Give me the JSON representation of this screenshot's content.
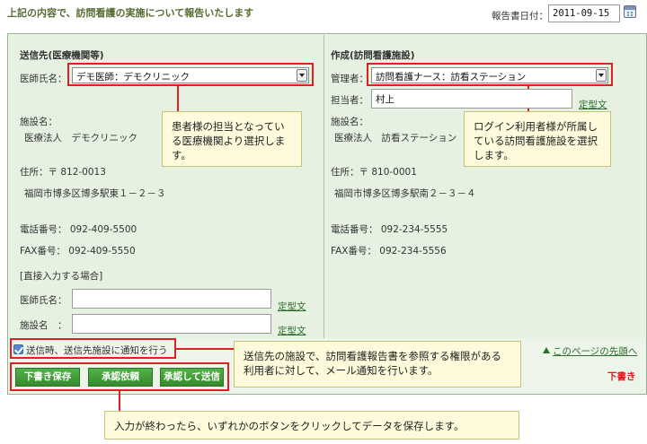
{
  "header": {
    "intro": "上記の内容で、訪問看護の実施について報告いたします",
    "report_date_label": "報告書日付：",
    "report_date": "2011-09-15"
  },
  "sender": {
    "title": "送信先(医療機関等)",
    "doctor_label": "医師氏名：",
    "doctor_selected": "デモ医師：デモクリニック",
    "facility_label": "施設名：",
    "facility_value": "医療法人　デモクリニック",
    "address_label": "住所：〒 812-0013",
    "address_value": "福岡市博多区博多駅東１－２－３",
    "phone": "電話番号：  092-409-5500",
    "fax": "FAX番号：  092-409-5550",
    "direct_input_label": "[直接入力する場合]",
    "direct_doctor_label": "医師氏名：",
    "direct_facility_label": "施設名　：",
    "template_link": "定型文"
  },
  "creator": {
    "title": "作成(訪問看護施設)",
    "manager_label": "管理者：",
    "manager_selected": "訪問看護ナース：訪看ステーション",
    "staff_label": "担当者：",
    "staff_value": "村上",
    "template_link": "定型文",
    "facility_label": "施設名：",
    "facility_value": "医療法人　訪看ステーション",
    "address_label": "住所：〒 810-0001",
    "address_value": "福岡市博多区博多駅南２－３－４",
    "phone": "電話番号：  092-234-5555",
    "fax": "FAX番号：  092-234-5556"
  },
  "notify": {
    "label": "送信時、送信先施設に通知を行う",
    "checked": true
  },
  "links": {
    "page_top": "このページの先頭へ",
    "draft_status": "下書き"
  },
  "buttons": {
    "save_draft": "下書き保存",
    "request_approval": "承認依頼",
    "approve_send": "承認して送信"
  },
  "callouts": {
    "doctor": "患者様の担当となっている医療機関より選択します。",
    "manager": "ログイン利用者様が所属している訪問看護施設を選択します。",
    "notify": "送信先の施設で、訪問看護報告書を参照する権限がある利用者に対して、メール通知を行います。",
    "buttons": "入力が終わったら、いずれかのボタンをクリックしてデータを保存します。"
  },
  "colors": {
    "accent_green": "#3e9a34",
    "panel_bg": "#e6f1e2",
    "highlight_red": "#e02020",
    "callout_bg": "#fdfbdc"
  }
}
